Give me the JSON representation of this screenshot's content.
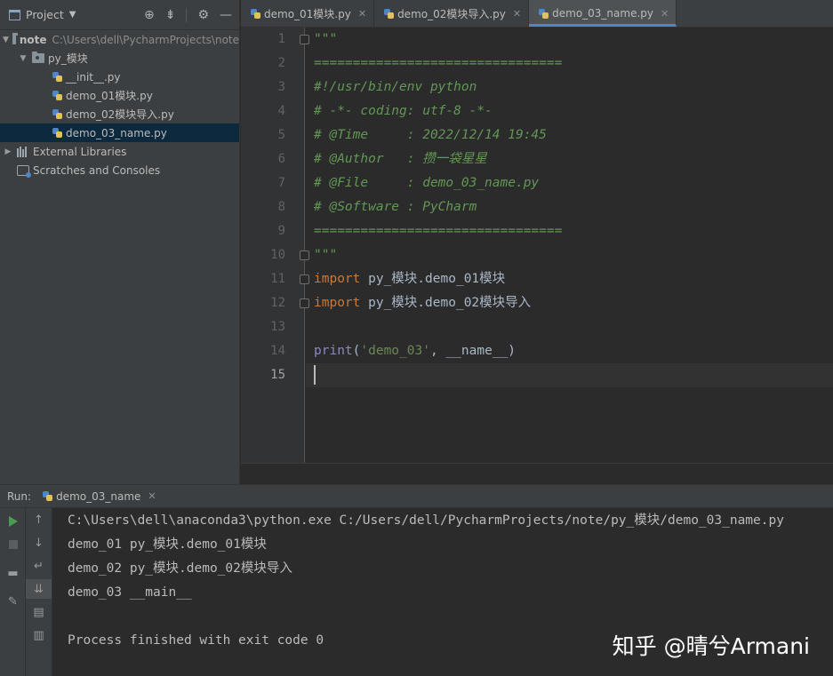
{
  "project_pane": {
    "title": "Project",
    "tree": [
      {
        "label": "note",
        "path": "C:\\Users\\dell\\PycharmProjects\\note"
      },
      {
        "label": "py_模块"
      },
      {
        "label": "__init__.py"
      },
      {
        "label": "demo_01模块.py"
      },
      {
        "label": "demo_02模块导入.py"
      },
      {
        "label": "demo_03_name.py"
      },
      {
        "label": "External Libraries"
      },
      {
        "label": "Scratches and Consoles"
      }
    ]
  },
  "editor": {
    "tabs": [
      {
        "label": "demo_01模块.py"
      },
      {
        "label": "demo_02模块导入.py"
      },
      {
        "label": "demo_03_name.py"
      }
    ],
    "line_numbers": [
      "1",
      "2",
      "3",
      "4",
      "5",
      "6",
      "7",
      "8",
      "9",
      "10",
      "11",
      "12",
      "13",
      "14",
      "15"
    ],
    "code": {
      "l1": "\"\"\"",
      "l2": "================================",
      "l3": "#!/usr/bin/env python",
      "l4": "# -*- coding: utf-8 -*-",
      "l5": "# @Time     : 2022/12/14 19:45",
      "l6": "# @Author   : 攒一袋星星",
      "l7": "# @File     : demo_03_name.py",
      "l8": "# @Software : PyCharm",
      "l9": "================================",
      "l10": "\"\"\"",
      "l11_kw": "import",
      "l11_rest": " py_模块.demo_01模块",
      "l12_kw": "import",
      "l12_rest": " py_模块.demo_02模块导入",
      "l14_fn": "print",
      "l14_open": "(",
      "l14_str": "'demo_03'",
      "l14_sep": ", ",
      "l14_dunder": "__name__",
      "l14_close": ")"
    }
  },
  "run_panel": {
    "label": "Run:",
    "tab": "demo_03_name",
    "output": [
      "C:\\Users\\dell\\anaconda3\\python.exe C:/Users/dell/PycharmProjects/note/py_模块/demo_03_name.py",
      "demo_01 py_模块.demo_01模块",
      "demo_02 py_模块.demo_02模块导入",
      "demo_03 __main__",
      "",
      "Process finished with exit code 0"
    ]
  },
  "watermark": "知乎 @晴兮Armani",
  "icons": [
    "project-icon",
    "locate-icon",
    "collapse-icon",
    "gear-icon",
    "hide-icon",
    "python-file-icon",
    "folder-icon",
    "library-icon",
    "scratch-icon",
    "run-icon",
    "stop-icon",
    "pin-icon",
    "print-icon",
    "trash-icon"
  ],
  "colors": {
    "accent": "#4a88c7",
    "keyword": "#cc7832",
    "docstring": "#629755",
    "string": "#6a8759",
    "builtin": "#8888c6",
    "dunder": "#b200b2",
    "selection": "#0d293e"
  }
}
